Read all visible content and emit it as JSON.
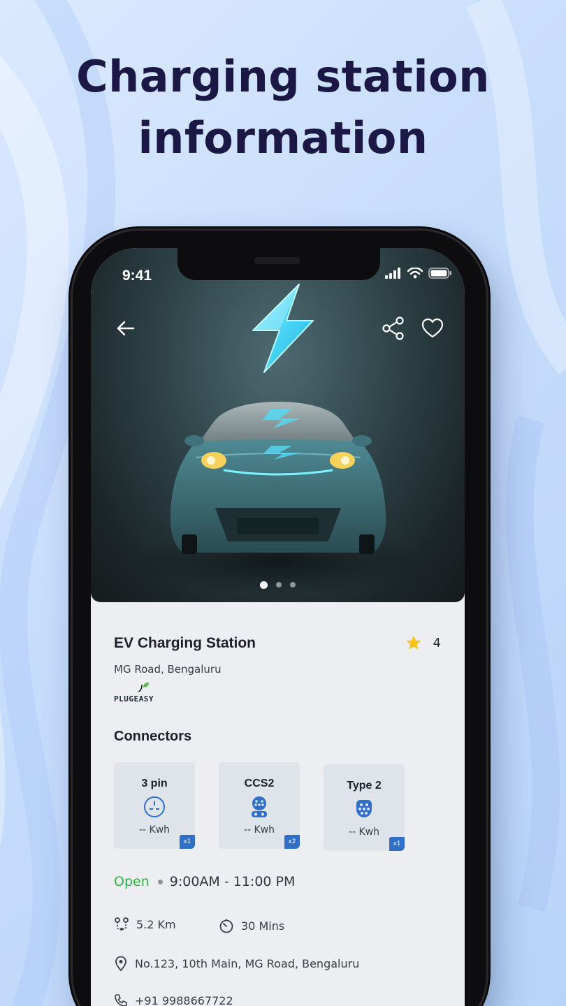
{
  "headline": {
    "line1": "Charging station",
    "line2": "information"
  },
  "status_bar": {
    "time": "9:41"
  },
  "hero": {
    "carousel_pages": 3,
    "active_page": 1
  },
  "station": {
    "name": "EV Charging Station",
    "rating": "4",
    "area": "MG Road, Bengaluru",
    "brand": "PLUGEASY"
  },
  "connectors": {
    "title": "Connectors",
    "items": [
      {
        "name": "3 pin",
        "power": "-- Kwh",
        "count": "x1",
        "icon": "3-pin-socket-icon"
      },
      {
        "name": "CCS2",
        "power": "-- Kwh",
        "count": "x2",
        "icon": "ccs2-socket-icon"
      },
      {
        "name": "Type 2",
        "power": "-- Kwh",
        "count": "x1",
        "icon": "type2-socket-icon"
      }
    ]
  },
  "details": {
    "status": "Open",
    "hours": "9:00AM - 11:00 PM",
    "distance": "5.2 Km",
    "duration": "30 Mins",
    "address": "No.123, 10th Main, MG Road, Bengaluru",
    "phone": "+91 9988667722"
  },
  "colors": {
    "accent_cyan": "#31d2f0",
    "open_green": "#2fb344",
    "badge_blue": "#2f6fca",
    "star_yellow": "#f5c518",
    "headline": "#1b1845"
  }
}
